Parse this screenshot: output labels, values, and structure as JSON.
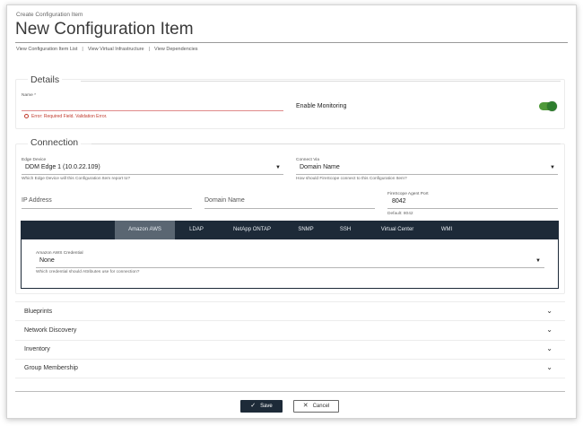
{
  "breadcrumb": "Create Configuration Item",
  "page_title": "New Configuration Item",
  "links": [
    "View Configuration Item List",
    "View Virtual Infrastructure",
    "View Dependencies"
  ],
  "details": {
    "heading": "Details",
    "name_label": "Name *",
    "name_value": "",
    "name_error": "Error: Required Field. Validation Error.",
    "monitoring_label": "Enable Monitoring",
    "monitoring_enabled": true
  },
  "connection": {
    "heading": "Connection",
    "edge_label": "Edge Device",
    "edge_value": "DDM Edge 1 (10.0.22.109)",
    "edge_hint": "Which Edge Device will this Configuration Item report to?",
    "via_label": "Connect Via",
    "via_value": "Domain Name",
    "via_hint": "How should FireScope connect to this Configuration Item?",
    "ip_placeholder": "IP Address",
    "domain_placeholder": "Domain Name",
    "port_label": "FireScope Agent Port",
    "port_value": "8042",
    "port_hint": "Default: 8042",
    "tabs": [
      "Amazon AWS",
      "LDAP",
      "NetApp ONTAP",
      "SNMP",
      "SSH",
      "Virtual Center",
      "WMI"
    ],
    "active_tab": "Amazon AWS",
    "credential_label": "Amazon AWS Credential",
    "credential_value": "None",
    "credential_hint": "Which credential should Attributes use for connection?"
  },
  "accordions": [
    "Blueprints",
    "Network Discovery",
    "Inventory",
    "Group Membership"
  ],
  "actions": {
    "save": "Save",
    "cancel": "Cancel"
  },
  "colors": {
    "nav_dark": "#1d2a38",
    "toggle_on": "#4f9a3a",
    "error": "#c0392b"
  }
}
